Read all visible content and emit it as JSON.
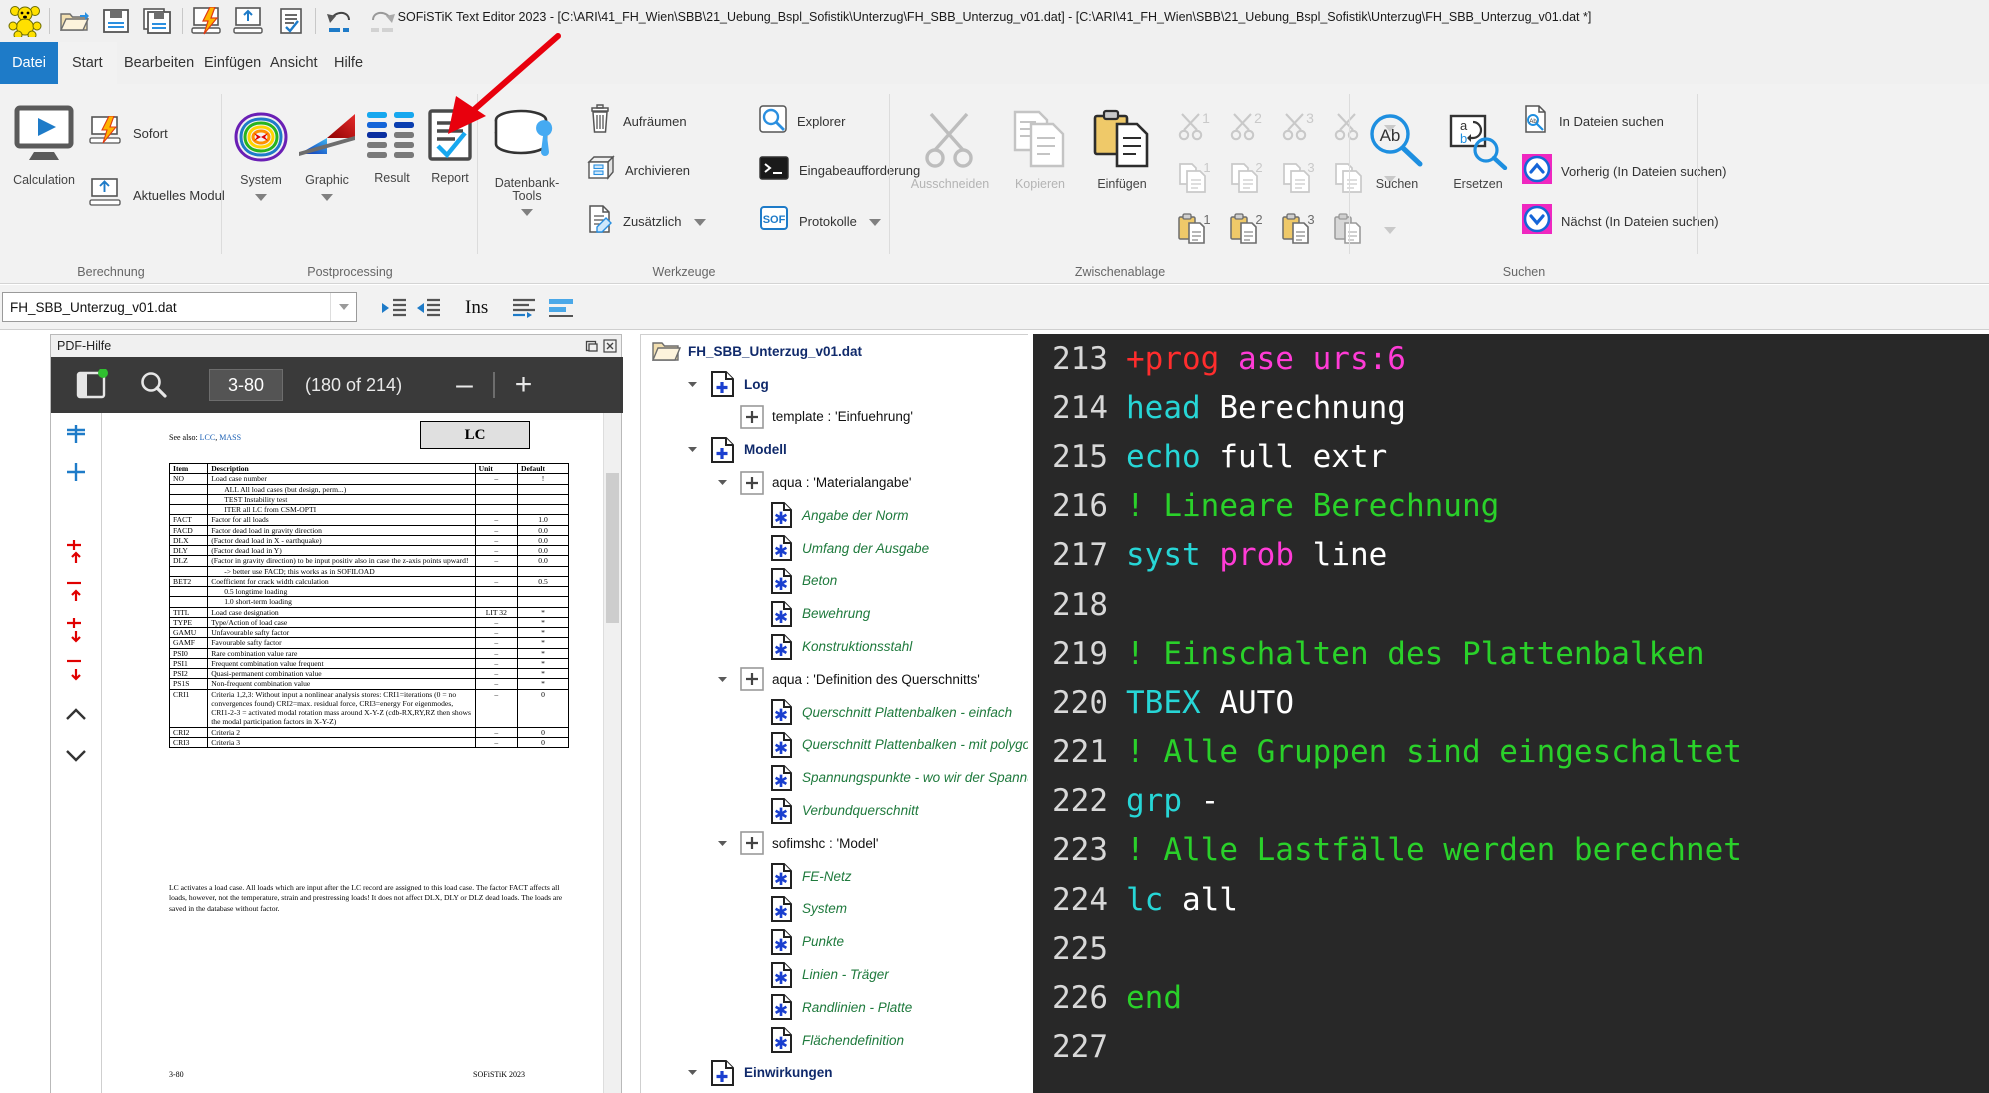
{
  "window": {
    "title": "SOFiSTiK Text Editor 2023 - [C:\\ARI\\41_FH_Wien\\SBB\\21_Uebung_Bspl_Sofistik\\Unterzug\\FH_SBB_Unterzug_v01.dat] - [C:\\ARI\\41_FH_Wien\\SBB\\21_Uebung_Bspl_Sofistik\\Unterzug\\FH_SBB_Unterzug_v01.dat *]"
  },
  "quick_access": [
    {
      "name": "sofistik-teddy-logo",
      "glyph": "bear"
    },
    {
      "name": "open-icon",
      "glyph": "folder"
    },
    {
      "name": "save-icon",
      "glyph": "floppy"
    },
    {
      "name": "save-all-icon",
      "glyph": "floppy-multi"
    },
    {
      "name": "calculate-icon",
      "glyph": "monitor-bolt"
    },
    {
      "name": "current-module-icon",
      "glyph": "monitor-up"
    },
    {
      "name": "report-icon",
      "glyph": "doc-check"
    },
    {
      "name": "undo-icon",
      "glyph": "undo"
    },
    {
      "name": "redo-icon",
      "glyph": "redo"
    }
  ],
  "tabs": [
    {
      "label": "Datei",
      "active": false,
      "file": true
    },
    {
      "label": "Start",
      "active": true
    },
    {
      "label": "Bearbeiten",
      "active": false
    },
    {
      "label": "Einfügen",
      "active": false
    },
    {
      "label": "Ansicht",
      "active": false
    },
    {
      "label": "Hilfe",
      "active": false
    }
  ],
  "ribbon": {
    "groups": [
      {
        "name": "berechnung",
        "label": "Berechnung",
        "big": {
          "label": "Calculation",
          "icon": "monitor-play-icon"
        },
        "items": [
          {
            "label": "Sofort",
            "icon": "monitor-bolt-icon"
          },
          {
            "label": "Aktuelles Modul",
            "icon": "monitor-up-icon"
          }
        ]
      },
      {
        "name": "postprocessing",
        "label": "Postprocessing",
        "items": [
          {
            "label": "System",
            "icon": "system-icon",
            "caret": true
          },
          {
            "label": "Graphic",
            "icon": "graphic-icon",
            "caret": true
          },
          {
            "label": "Result",
            "icon": "result-icon",
            "caret": false
          },
          {
            "label": "Report",
            "icon": "report-icon",
            "caret": false
          }
        ]
      },
      {
        "name": "werkzeuge",
        "label": "Werkzeuge",
        "items": [
          {
            "label": "Datenbank-Tools",
            "icon": "database-tools-icon",
            "caret": true
          },
          {
            "label": "Aufräumen",
            "icon": "trash-icon"
          },
          {
            "label": "Archivieren",
            "icon": "archive-icon"
          },
          {
            "label": "Zusätzlich",
            "icon": "edit-doc-icon",
            "caret": true
          },
          {
            "label": "Explorer",
            "icon": "explorer-icon"
          },
          {
            "label": "Eingabeaufforderung",
            "icon": "console-icon"
          },
          {
            "label": "Protokolle",
            "icon": "sof-icon",
            "caret": true
          }
        ]
      },
      {
        "name": "zwischenablage",
        "label": "Zwischenablage",
        "items": [
          {
            "label": "Ausschneiden",
            "icon": "scissors-icon",
            "disabled": true
          },
          {
            "label": "Kopieren",
            "icon": "copy-icon",
            "disabled": true
          },
          {
            "label": "Einfügen",
            "icon": "paste-icon",
            "disabled": false
          }
        ],
        "slots": [
          "1",
          "2",
          "3",
          ""
        ]
      },
      {
        "name": "suchen",
        "label": "Suchen",
        "items": [
          {
            "label": "Suchen",
            "icon": "find-icon"
          },
          {
            "label": "Ersetzen",
            "icon": "replace-icon"
          },
          {
            "label": "In Dateien suchen",
            "icon": "find-in-files-icon"
          },
          {
            "label": "Vorherig (In Dateien suchen)",
            "icon": "chevron-up-icon"
          },
          {
            "label": "Nächst (In Dateien suchen)",
            "icon": "chevron-down-icon"
          }
        ]
      }
    ]
  },
  "pathbar": {
    "file_value": "FH_SBB_Unterzug_v01.dat",
    "ins_label": "Ins",
    "buttons": [
      {
        "name": "indent-increase-icon"
      },
      {
        "name": "indent-decrease-icon"
      },
      {
        "name": "align-left-icon"
      },
      {
        "name": "wordwrap-icon"
      }
    ]
  },
  "pdf": {
    "caption": "PDF-Hilfe",
    "page_value": "3-80",
    "page_count": "(180 of 214)",
    "zoom_out": "–",
    "zoom_in": "+",
    "doc": {
      "see_also_prefix": "See also:",
      "see_also_links": [
        "LCC",
        "MASS"
      ],
      "title_box": "LC",
      "headers": [
        "Item",
        "Description",
        "Unit",
        "Default"
      ],
      "rows": [
        {
          "item": "NO",
          "desc": "Load case number",
          "unit": "–",
          "def": "!"
        },
        {
          "item": "",
          "desc": "ALL       All load cases (but design, perm...)",
          "unit": "",
          "def": "",
          "indent": 1
        },
        {
          "item": "",
          "desc": "TEST      Instability test",
          "unit": "",
          "def": "",
          "indent": 1
        },
        {
          "item": "",
          "desc": "ITER      all LC from CSM-OPTI",
          "unit": "",
          "def": "",
          "indent": 1
        },
        {
          "item": "FACT",
          "desc": "Factor for all loads",
          "unit": "–",
          "def": "1.0"
        },
        {
          "item": "FACD",
          "desc": "Factor dead load in gravity direction",
          "unit": "–",
          "def": "0.0"
        },
        {
          "item": "DLX",
          "desc": "(Factor dead load in X - earthquake)",
          "unit": "–",
          "def": "0.0"
        },
        {
          "item": "DLY",
          "desc": "(Factor dead load in Y)",
          "unit": "–",
          "def": "0.0"
        },
        {
          "item": "DLZ",
          "desc": "(Factor in gravity direction) to be input positiv also in case the z-axis points upward!",
          "unit": "–",
          "def": "0.0"
        },
        {
          "item": "",
          "desc": "-> better use FACD; this works as in SOFILOAD",
          "unit": "",
          "def": "",
          "indent": 1
        },
        {
          "item": "BET2",
          "desc": "Coefficient for crack width calculation",
          "unit": "–",
          "def": "0.5"
        },
        {
          "item": "",
          "desc": "0.5       longtime loading",
          "unit": "",
          "def": "",
          "indent": 1
        },
        {
          "item": "",
          "desc": "1.0       short-term loading",
          "unit": "",
          "def": "",
          "indent": 1
        },
        {
          "item": "TITL",
          "desc": "Load case designation",
          "unit": "LIT 32",
          "def": "*"
        },
        {
          "item": "TYPE",
          "desc": "Type/Action of load case",
          "unit": "–",
          "def": "*"
        },
        {
          "item": "GAMU",
          "desc": "Unfavourable safty factor",
          "unit": "–",
          "def": "*"
        },
        {
          "item": "GAMF",
          "desc": "Favourable safty factor",
          "unit": "–",
          "def": "*"
        },
        {
          "item": "PSI0",
          "desc": "Rare combination value rare",
          "unit": "–",
          "def": "*"
        },
        {
          "item": "PSI1",
          "desc": "Frequent combination value frequent",
          "unit": "–",
          "def": "*"
        },
        {
          "item": "PSI2",
          "desc": "Quasi-permanent combination value",
          "unit": "–",
          "def": "*"
        },
        {
          "item": "PS1S",
          "desc": "Non-frequent combination value",
          "unit": "–",
          "def": "*"
        },
        {
          "item": "CRI1",
          "desc": "Criteria 1,2,3: Without input a nonlinear analysis stores: CRI1=iterations (0 = no convergences found) CRI2=max. residual force, CRI3=energy For eigenmodes, CRI1-2-3 = activated modal rotation mass around X-Y-Z (cdb-RX,RY,RZ then shows the modal participation factors in X-Y-Z)",
          "unit": "–",
          "def": "0"
        },
        {
          "item": "CRI2",
          "desc": "Criteria 2",
          "unit": "–",
          "def": "0"
        },
        {
          "item": "CRI3",
          "desc": "Criteria 3",
          "unit": "–",
          "def": "0"
        }
      ],
      "note": "LC activates a load case. All loads which are input after the LC record are assigned to this load case. The factor FACT affects all loads, however, not the temperature, strain and prestressing loads!  It does not affect DLX, DLY or DLZ dead loads.  The loads are saved in the database without factor.",
      "footer_left": "3-80",
      "footer_right": "SOFiSTiK 2023"
    }
  },
  "tree": {
    "root": "FH_SBB_Unterzug_v01.dat",
    "nodes": [
      {
        "label": "Log",
        "depth": 1,
        "style": "b",
        "icon": "doc-plus-icon",
        "expander": "down"
      },
      {
        "label": "template : 'Einfuehrung'",
        "depth": 2,
        "style": "k",
        "icon": "plus-box-icon",
        "expander": ""
      },
      {
        "label": "Modell",
        "depth": 1,
        "style": "b",
        "icon": "doc-plus-icon",
        "expander": "down"
      },
      {
        "label": "aqua : 'Materialangabe'",
        "depth": 2,
        "style": "k",
        "icon": "plus-box-icon",
        "expander": "down"
      },
      {
        "label": "Angabe der Norm",
        "depth": 3,
        "style": "g",
        "icon": "doc-star-icon",
        "expander": ""
      },
      {
        "label": "Umfang der Ausgabe",
        "depth": 3,
        "style": "g",
        "icon": "doc-star-icon",
        "expander": ""
      },
      {
        "label": "Beton",
        "depth": 3,
        "style": "g",
        "icon": "doc-star-icon",
        "expander": ""
      },
      {
        "label": "Bewehrung",
        "depth": 3,
        "style": "g",
        "icon": "doc-star-icon",
        "expander": ""
      },
      {
        "label": "Konstruktionsstahl",
        "depth": 3,
        "style": "g",
        "icon": "doc-star-icon",
        "expander": ""
      },
      {
        "label": "aqua : 'Definition des Querschnitts'",
        "depth": 2,
        "style": "k",
        "icon": "plus-box-icon",
        "expander": "down"
      },
      {
        "label": "Querschnitt Plattenbalken - einfach",
        "depth": 3,
        "style": "g",
        "icon": "doc-star-icon",
        "expander": ""
      },
      {
        "label": "Querschnitt Plattenbalken - mit polygo...",
        "depth": 3,
        "style": "g",
        "icon": "doc-star-icon",
        "expander": ""
      },
      {
        "label": "Spannungspunkte - wo wir der Spannu...",
        "depth": 3,
        "style": "g",
        "icon": "doc-star-icon",
        "expander": ""
      },
      {
        "label": "Verbundquerschnitt",
        "depth": 3,
        "style": "g",
        "icon": "doc-star-icon",
        "expander": ""
      },
      {
        "label": "sofimshc : 'Model'",
        "depth": 2,
        "style": "k",
        "icon": "plus-box-icon",
        "expander": "down"
      },
      {
        "label": "FE-Netz",
        "depth": 3,
        "style": "g",
        "icon": "doc-star-icon",
        "expander": ""
      },
      {
        "label": "System",
        "depth": 3,
        "style": "g",
        "icon": "doc-star-icon",
        "expander": ""
      },
      {
        "label": "Punkte",
        "depth": 3,
        "style": "g",
        "icon": "doc-star-icon",
        "expander": ""
      },
      {
        "label": "Linien - Träger",
        "depth": 3,
        "style": "g",
        "icon": "doc-star-icon",
        "expander": ""
      },
      {
        "label": "Randlinien - Platte",
        "depth": 3,
        "style": "g",
        "icon": "doc-star-icon",
        "expander": ""
      },
      {
        "label": "Flächendefinition",
        "depth": 3,
        "style": "g",
        "icon": "doc-star-icon",
        "expander": ""
      },
      {
        "label": "Einwirkungen",
        "depth": 1,
        "style": "b",
        "icon": "doc-plus-icon",
        "expander": "down"
      }
    ]
  },
  "editor": {
    "lines": [
      {
        "num": "213",
        "tokens": [
          {
            "t": "+prog ",
            "c": "k-red"
          },
          {
            "t": "ase ",
            "c": "k-purple"
          },
          {
            "t": "urs:6",
            "c": "k-purple"
          }
        ]
      },
      {
        "num": "214",
        "tokens": [
          {
            "t": "head ",
            "c": "k-cyan"
          },
          {
            "t": "Berechnung",
            "c": "k-white"
          }
        ]
      },
      {
        "num": "215",
        "tokens": [
          {
            "t": "echo ",
            "c": "k-cyan"
          },
          {
            "t": "full extr",
            "c": "k-white"
          }
        ]
      },
      {
        "num": "216",
        "tokens": [
          {
            "t": "! Lineare Berechnung",
            "c": "k-green"
          }
        ]
      },
      {
        "num": "217",
        "tokens": [
          {
            "t": "syst ",
            "c": "k-cyan"
          },
          {
            "t": "prob ",
            "c": "k-purple"
          },
          {
            "t": "line",
            "c": "k-white"
          }
        ]
      },
      {
        "num": "218",
        "tokens": [
          {
            "t": "",
            "c": "k-white"
          }
        ]
      },
      {
        "num": "219",
        "tokens": [
          {
            "t": "! Einschalten des Plattenbalken",
            "c": "k-green"
          }
        ]
      },
      {
        "num": "220",
        "tokens": [
          {
            "t": "TBEX ",
            "c": "k-cyan"
          },
          {
            "t": "AUTO",
            "c": "k-white"
          }
        ]
      },
      {
        "num": "221",
        "tokens": [
          {
            "t": "! Alle Gruppen sind eingeschaltet",
            "c": "k-green"
          }
        ]
      },
      {
        "num": "222",
        "tokens": [
          {
            "t": "grp ",
            "c": "k-cyan"
          },
          {
            "t": "-",
            "c": "k-white"
          }
        ]
      },
      {
        "num": "223",
        "tokens": [
          {
            "t": "! Alle Lastfälle werden berechnet",
            "c": "k-green"
          }
        ]
      },
      {
        "num": "224",
        "tokens": [
          {
            "t": "lc ",
            "c": "k-cyan"
          },
          {
            "t": "all",
            "c": "k-white"
          }
        ]
      },
      {
        "num": "225",
        "tokens": [
          {
            "t": "",
            "c": "k-white"
          }
        ]
      },
      {
        "num": "226",
        "tokens": [
          {
            "t": "end",
            "c": "k-green"
          }
        ]
      },
      {
        "num": "227",
        "tokens": [
          {
            "t": "",
            "c": "k-white"
          }
        ]
      }
    ]
  },
  "annotation": {
    "name": "red-arrow",
    "color": "#e8000d",
    "points_to": "Report"
  },
  "colors": {
    "accent_blue": "#1e7bc8",
    "ribbon_bg": "#f2f2f2",
    "editor_bg": "#282828",
    "magenta": "#ef27c0"
  }
}
